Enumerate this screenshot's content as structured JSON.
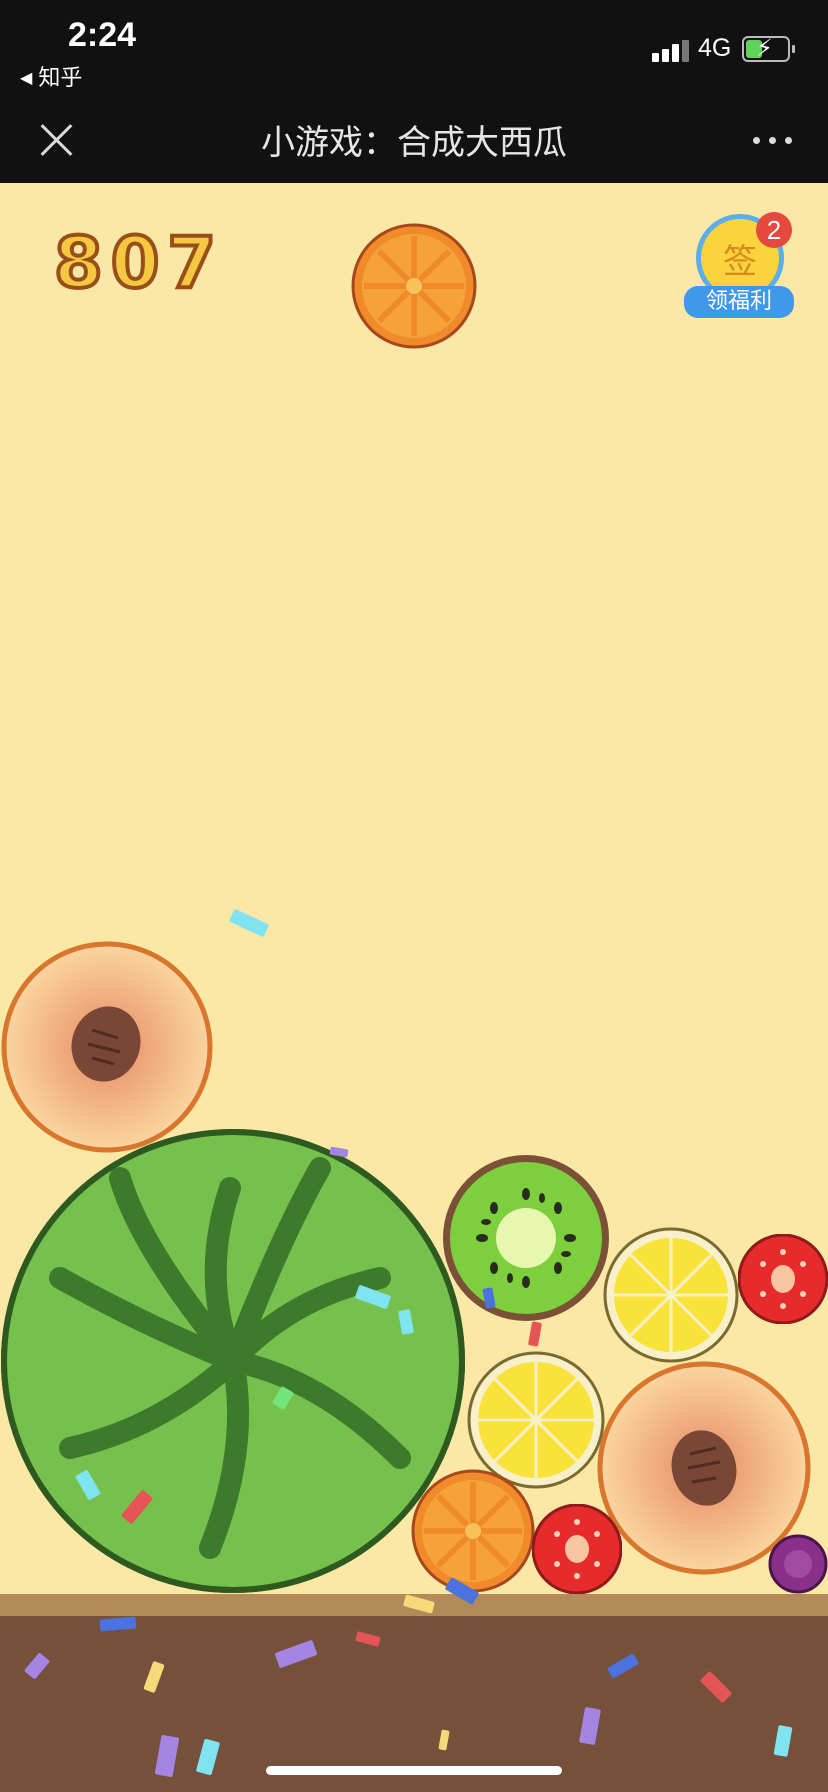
{
  "status_bar": {
    "time": "2:24",
    "back_app": "知乎",
    "network": "4G"
  },
  "navbar": {
    "title": "小游戏：合成大西瓜"
  },
  "game": {
    "score": "807",
    "sign_in": {
      "icon_char": "签",
      "badge_count": "2",
      "label": "领福利"
    },
    "next_fruit": "orange"
  },
  "colors": {
    "background": "#fbe8a6",
    "ground": "#75513c",
    "ground_strip": "#b48a59",
    "score_fill": "#f5c842",
    "score_stroke": "#9a4f19",
    "badge": "#e5493e",
    "button_blue": "#3f98e9"
  },
  "fruits": [
    "orange",
    "peach",
    "watermelon",
    "kiwi",
    "lemon",
    "strawberry",
    "lemon",
    "peach",
    "orange",
    "strawberry",
    "grape"
  ]
}
